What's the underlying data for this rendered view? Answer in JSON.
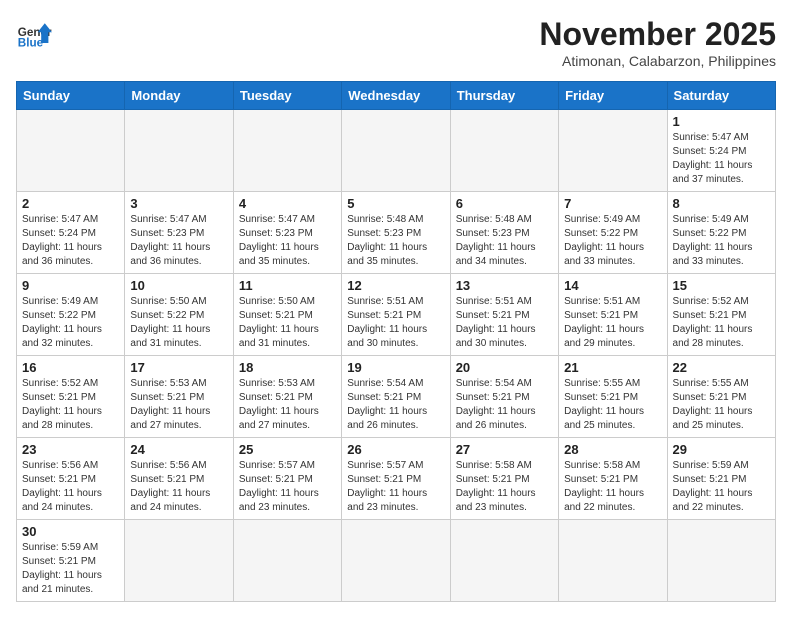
{
  "logo": {
    "text_general": "General",
    "text_blue": "Blue"
  },
  "header": {
    "month": "November 2025",
    "location": "Atimonan, Calabarzon, Philippines"
  },
  "weekdays": [
    "Sunday",
    "Monday",
    "Tuesday",
    "Wednesday",
    "Thursday",
    "Friday",
    "Saturday"
  ],
  "weeks": [
    [
      {
        "day": "",
        "info": ""
      },
      {
        "day": "",
        "info": ""
      },
      {
        "day": "",
        "info": ""
      },
      {
        "day": "",
        "info": ""
      },
      {
        "day": "",
        "info": ""
      },
      {
        "day": "",
        "info": ""
      },
      {
        "day": "1",
        "info": "Sunrise: 5:47 AM\nSunset: 5:24 PM\nDaylight: 11 hours\nand 37 minutes."
      }
    ],
    [
      {
        "day": "2",
        "info": "Sunrise: 5:47 AM\nSunset: 5:24 PM\nDaylight: 11 hours\nand 36 minutes."
      },
      {
        "day": "3",
        "info": "Sunrise: 5:47 AM\nSunset: 5:23 PM\nDaylight: 11 hours\nand 36 minutes."
      },
      {
        "day": "4",
        "info": "Sunrise: 5:47 AM\nSunset: 5:23 PM\nDaylight: 11 hours\nand 35 minutes."
      },
      {
        "day": "5",
        "info": "Sunrise: 5:48 AM\nSunset: 5:23 PM\nDaylight: 11 hours\nand 35 minutes."
      },
      {
        "day": "6",
        "info": "Sunrise: 5:48 AM\nSunset: 5:23 PM\nDaylight: 11 hours\nand 34 minutes."
      },
      {
        "day": "7",
        "info": "Sunrise: 5:49 AM\nSunset: 5:22 PM\nDaylight: 11 hours\nand 33 minutes."
      },
      {
        "day": "8",
        "info": "Sunrise: 5:49 AM\nSunset: 5:22 PM\nDaylight: 11 hours\nand 33 minutes."
      }
    ],
    [
      {
        "day": "9",
        "info": "Sunrise: 5:49 AM\nSunset: 5:22 PM\nDaylight: 11 hours\nand 32 minutes."
      },
      {
        "day": "10",
        "info": "Sunrise: 5:50 AM\nSunset: 5:22 PM\nDaylight: 11 hours\nand 31 minutes."
      },
      {
        "day": "11",
        "info": "Sunrise: 5:50 AM\nSunset: 5:21 PM\nDaylight: 11 hours\nand 31 minutes."
      },
      {
        "day": "12",
        "info": "Sunrise: 5:51 AM\nSunset: 5:21 PM\nDaylight: 11 hours\nand 30 minutes."
      },
      {
        "day": "13",
        "info": "Sunrise: 5:51 AM\nSunset: 5:21 PM\nDaylight: 11 hours\nand 30 minutes."
      },
      {
        "day": "14",
        "info": "Sunrise: 5:51 AM\nSunset: 5:21 PM\nDaylight: 11 hours\nand 29 minutes."
      },
      {
        "day": "15",
        "info": "Sunrise: 5:52 AM\nSunset: 5:21 PM\nDaylight: 11 hours\nand 28 minutes."
      }
    ],
    [
      {
        "day": "16",
        "info": "Sunrise: 5:52 AM\nSunset: 5:21 PM\nDaylight: 11 hours\nand 28 minutes."
      },
      {
        "day": "17",
        "info": "Sunrise: 5:53 AM\nSunset: 5:21 PM\nDaylight: 11 hours\nand 27 minutes."
      },
      {
        "day": "18",
        "info": "Sunrise: 5:53 AM\nSunset: 5:21 PM\nDaylight: 11 hours\nand 27 minutes."
      },
      {
        "day": "19",
        "info": "Sunrise: 5:54 AM\nSunset: 5:21 PM\nDaylight: 11 hours\nand 26 minutes."
      },
      {
        "day": "20",
        "info": "Sunrise: 5:54 AM\nSunset: 5:21 PM\nDaylight: 11 hours\nand 26 minutes."
      },
      {
        "day": "21",
        "info": "Sunrise: 5:55 AM\nSunset: 5:21 PM\nDaylight: 11 hours\nand 25 minutes."
      },
      {
        "day": "22",
        "info": "Sunrise: 5:55 AM\nSunset: 5:21 PM\nDaylight: 11 hours\nand 25 minutes."
      }
    ],
    [
      {
        "day": "23",
        "info": "Sunrise: 5:56 AM\nSunset: 5:21 PM\nDaylight: 11 hours\nand 24 minutes."
      },
      {
        "day": "24",
        "info": "Sunrise: 5:56 AM\nSunset: 5:21 PM\nDaylight: 11 hours\nand 24 minutes."
      },
      {
        "day": "25",
        "info": "Sunrise: 5:57 AM\nSunset: 5:21 PM\nDaylight: 11 hours\nand 23 minutes."
      },
      {
        "day": "26",
        "info": "Sunrise: 5:57 AM\nSunset: 5:21 PM\nDaylight: 11 hours\nand 23 minutes."
      },
      {
        "day": "27",
        "info": "Sunrise: 5:58 AM\nSunset: 5:21 PM\nDaylight: 11 hours\nand 23 minutes."
      },
      {
        "day": "28",
        "info": "Sunrise: 5:58 AM\nSunset: 5:21 PM\nDaylight: 11 hours\nand 22 minutes."
      },
      {
        "day": "29",
        "info": "Sunrise: 5:59 AM\nSunset: 5:21 PM\nDaylight: 11 hours\nand 22 minutes."
      }
    ],
    [
      {
        "day": "30",
        "info": "Sunrise: 5:59 AM\nSunset: 5:21 PM\nDaylight: 11 hours\nand 21 minutes."
      },
      {
        "day": "",
        "info": ""
      },
      {
        "day": "",
        "info": ""
      },
      {
        "day": "",
        "info": ""
      },
      {
        "day": "",
        "info": ""
      },
      {
        "day": "",
        "info": ""
      },
      {
        "day": "",
        "info": ""
      }
    ]
  ]
}
